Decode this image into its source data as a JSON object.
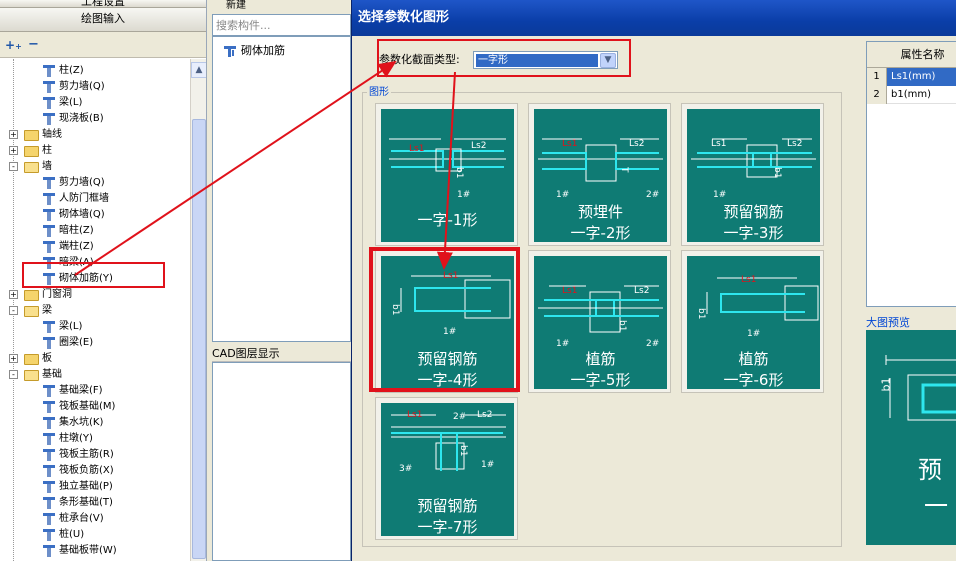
{
  "left_nav": {
    "top_button": "工程设置",
    "draw_button": "绘图输入",
    "tree": [
      {
        "label": "柱(Z)",
        "indent": 3,
        "icon": "column-icon"
      },
      {
        "label": "剪力墙(Q)",
        "indent": 3,
        "icon": "shear-wall-icon"
      },
      {
        "label": "梁(L)",
        "indent": 3,
        "icon": "beam-icon"
      },
      {
        "label": "现浇板(B)",
        "indent": 3,
        "icon": "slab-icon"
      },
      {
        "label": "轴线",
        "indent": 1,
        "icon": "folder-icon",
        "expander": "+"
      },
      {
        "label": "柱",
        "indent": 1,
        "icon": "folder-icon",
        "expander": "+"
      },
      {
        "label": "墙",
        "indent": 1,
        "icon": "folder-open-icon",
        "expander": "-"
      },
      {
        "label": "剪力墙(Q)",
        "indent": 3,
        "icon": "shear-wall-icon"
      },
      {
        "label": "人防门框墙",
        "indent": 3,
        "icon": "door-frame-wall-icon"
      },
      {
        "label": "砌体墙(Q)",
        "indent": 3,
        "icon": "masonry-wall-icon"
      },
      {
        "label": "暗柱(Z)",
        "indent": 3,
        "icon": "hidden-column-icon"
      },
      {
        "label": "端柱(Z)",
        "indent": 3,
        "icon": "end-column-icon"
      },
      {
        "label": "暗梁(A)",
        "indent": 3,
        "icon": "hidden-beam-icon"
      },
      {
        "label": "砌体加筋(Y)",
        "indent": 3,
        "icon": "masonry-rebar-icon"
      },
      {
        "label": "门窗洞",
        "indent": 1,
        "icon": "folder-icon",
        "expander": "+"
      },
      {
        "label": "梁",
        "indent": 1,
        "icon": "folder-open-icon",
        "expander": "-"
      },
      {
        "label": "梁(L)",
        "indent": 3,
        "icon": "beam-icon"
      },
      {
        "label": "圈梁(E)",
        "indent": 3,
        "icon": "ring-beam-icon"
      },
      {
        "label": "板",
        "indent": 1,
        "icon": "folder-icon",
        "expander": "+"
      },
      {
        "label": "基础",
        "indent": 1,
        "icon": "folder-open-icon",
        "expander": "-"
      },
      {
        "label": "基础梁(F)",
        "indent": 3,
        "icon": "foundation-beam-icon"
      },
      {
        "label": "筏板基础(M)",
        "indent": 3,
        "icon": "raft-foundation-icon"
      },
      {
        "label": "集水坑(K)",
        "indent": 3,
        "icon": "sump-pit-icon"
      },
      {
        "label": "柱墩(Y)",
        "indent": 3,
        "icon": "column-pier-icon"
      },
      {
        "label": "筏板主筋(R)",
        "indent": 3,
        "icon": "raft-main-rebar-icon"
      },
      {
        "label": "筏板负筋(X)",
        "indent": 3,
        "icon": "raft-neg-rebar-icon"
      },
      {
        "label": "独立基础(P)",
        "indent": 3,
        "icon": "isolated-foundation-icon"
      },
      {
        "label": "条形基础(T)",
        "indent": 3,
        "icon": "strip-foundation-icon"
      },
      {
        "label": "桩承台(V)",
        "indent": 3,
        "icon": "pile-cap-icon"
      },
      {
        "label": "桩(U)",
        "indent": 3,
        "icon": "pile-icon"
      },
      {
        "label": "基础板带(W)",
        "indent": 3,
        "icon": "foundation-strip-icon"
      }
    ]
  },
  "middle": {
    "new_button": "新建",
    "search_placeholder": "搜索构件...",
    "component_item": "砌体加筋",
    "cad_layer_title": "CAD图层显示"
  },
  "dialog": {
    "title": "选择参数化图形",
    "type_label": "参数化截面类型:",
    "type_value": "一字形",
    "group_label": "图形",
    "tiles": [
      {
        "line1": "一字-1形",
        "line2": ""
      },
      {
        "line1": "预埋件",
        "line2": "一字-2形"
      },
      {
        "line1": "预留钢筋",
        "line2": "一字-3形"
      },
      {
        "line1": "预留钢筋",
        "line2": "一字-4形"
      },
      {
        "line1": "植筋",
        "line2": "一字-5形"
      },
      {
        "line1": "植筋",
        "line2": "一字-6形"
      },
      {
        "line1": "预留钢筋",
        "line2": "一字-7形"
      }
    ],
    "selected_tile": 4,
    "props_header": "属性名称",
    "props": [
      {
        "n": "1",
        "name": "Ls1(mm)"
      },
      {
        "n": "2",
        "name": "b1(mm)"
      }
    ],
    "preview_label": "大图预览",
    "preview_text1": "预",
    "preview_text2": "一",
    "preview_dim": "b1"
  },
  "diagram_labels": {
    "ls1": "Ls1",
    "ls2": "Ls2",
    "b1": "b1",
    "t": "T",
    "r1": "1#",
    "r2": "2#",
    "r3": "3#"
  },
  "colors": {
    "teal": "#0f7b74",
    "cyan": "#2ee6ee",
    "red": "#e0121b",
    "title_blue": "#0a3ea8"
  }
}
